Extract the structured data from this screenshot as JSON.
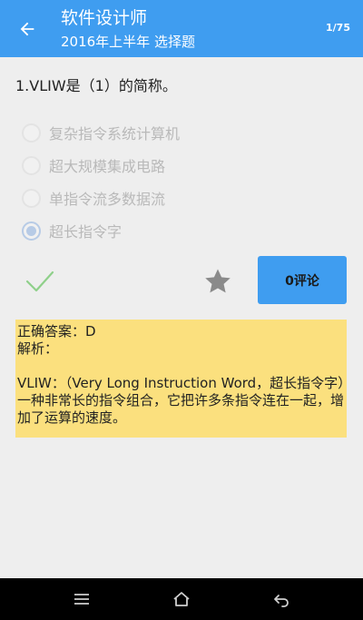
{
  "header": {
    "title": "软件设计师",
    "subtitle": "2016年上半年 选择题",
    "page_indicator": "1/75"
  },
  "question": {
    "text": "1.VLIW是（1）的简称。",
    "options": [
      {
        "label": "复杂指令系统计算机",
        "selected": false
      },
      {
        "label": "超大规模集成电路",
        "selected": false
      },
      {
        "label": "单指令流多数据流",
        "selected": false
      },
      {
        "label": "超长指令字",
        "selected": true
      }
    ]
  },
  "actions": {
    "comment_label": "0评论"
  },
  "answer": {
    "correct": "正确答案：D",
    "analysis_label": "解析：",
    "analysis_text": "VLIW：（Very Long Instruction Word，超长指令字）一种非常长的指令组合，它把许多条指令连在一起，增加了运算的速度。"
  },
  "colors": {
    "accent": "#3f9df0",
    "answer_bg": "#fbe07e",
    "check": "#8fd08a",
    "star": "#8a8a8a"
  },
  "icons": {
    "back": "arrow-left-icon",
    "check": "check-icon",
    "star": "star-icon",
    "nav_menu": "menu-icon",
    "nav_home": "home-icon",
    "nav_back": "back-icon"
  }
}
